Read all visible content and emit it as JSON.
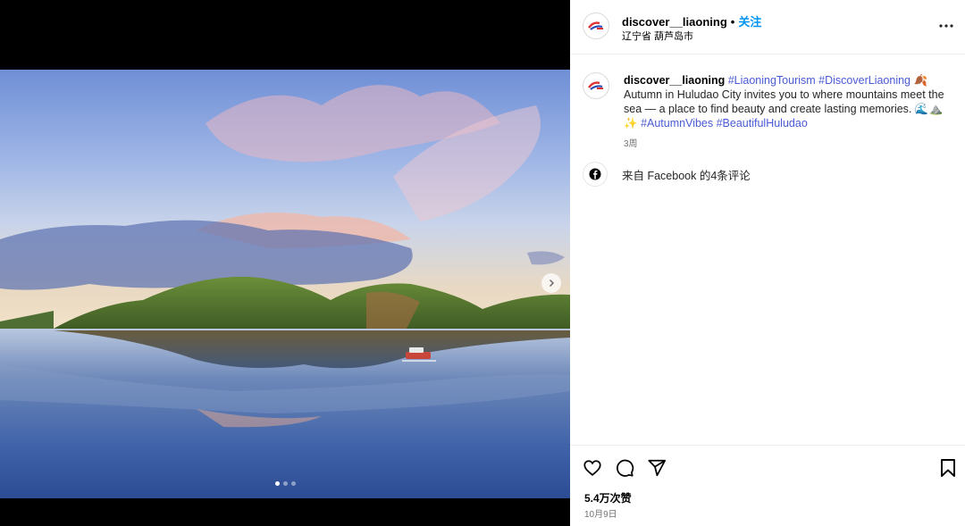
{
  "post": {
    "username": "discover__liaoning",
    "follow_label": "关注",
    "separator": "•",
    "location": "辽宁省 葫芦岛市"
  },
  "caption": {
    "username": "discover__liaoning",
    "tags_line1": "#LiaoningTourism #DiscoverLiaoning",
    "text": "Autumn in Huludao City invites you to where mountains meet the sea — a place to find beauty and create lasting memories.",
    "tags_line2": "#AutumnVibes #BeautifulHuludao",
    "time_ago": "3周"
  },
  "comments": {
    "facebook_label": "来自 Facebook 的4条评论"
  },
  "carousel": {
    "slide_count": 3,
    "active_index": 0
  },
  "footer": {
    "likes": "5.4万次赞",
    "date": "10月9日"
  },
  "icons": {
    "more": "more-horizontal-icon",
    "like": "heart-icon",
    "comment": "comment-icon",
    "share": "send-icon",
    "save": "bookmark-icon",
    "next": "chevron-right-icon",
    "facebook": "facebook-icon"
  },
  "colors": {
    "follow": "#0095f6",
    "hashtag": "#4a5ad5"
  }
}
